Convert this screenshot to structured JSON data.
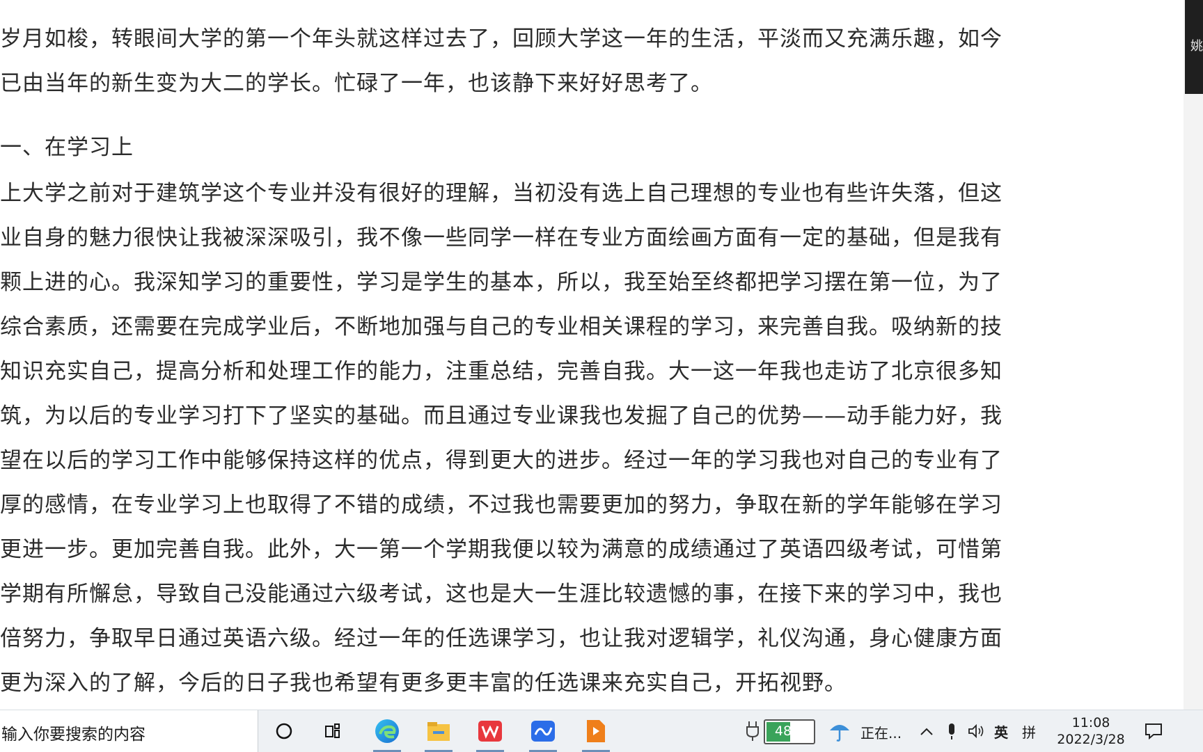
{
  "document": {
    "para1": [
      "岁月如梭，转眼间大学的第一个年头就这样过去了，回顾大学这一年的生活，平淡而又充满乐趣，如今",
      "已由当年的新生变为大二的学长。忙碌了一年，也该静下来好好思考了。"
    ],
    "heading": "一、在学习上",
    "para2": [
      "上大学之前对于建筑学这个专业并没有很好的理解，当初没有选上自己理想的专业也有些许失落，但这",
      "业自身的魅力很快让我被深深吸引，我不像一些同学一样在专业方面绘画方面有一定的基础，但是我有",
      "颗上进的心。我深知学习的重要性，学习是学生的基本，所以，我至始至终都把学习摆在第一位，为了",
      "综合素质，还需要在完成学业后，不断地加强与自己的专业相关课程的学习，来完善自我。吸纳新的技",
      "知识充实自己，提高分析和处理工作的能力，注重总结，完善自我。大一这一年我也走访了北京很多知",
      "筑，为以后的专业学习打下了坚实的基础。而且通过专业课我也发掘了自己的优势——动手能力好，我",
      "望在以后的学习工作中能够保持这样的优点，得到更大的进步。经过一年的学习我也对自己的专业有了",
      "厚的感情，在专业学习上也取得了不错的成绩，不过我也需要更加的努力，争取在新的学年能够在学习",
      "更进一步。更加完善自我。此外，大一第一个学期我便以较为满意的成绩通过了英语四级考试，可惜第",
      "学期有所懈怠，导致自己没能通过六级考试，这也是大一生涯比较遗憾的事，在接下来的学习中，我也",
      "倍努力，争取早日通过英语六级。经过一年的任选课学习，也让我对逻辑学，礼仪沟通，身心健康方面",
      "更为深入的了解，今后的日子我也希望有更多更丰富的任选课来充实自己，开拓视野。"
    ]
  },
  "side_window": {
    "label": "姚"
  },
  "taskbar": {
    "search_placeholder": "输入你要搜索的内容",
    "apps": [
      {
        "name": "cortana-icon"
      },
      {
        "name": "task-view-icon"
      },
      {
        "name": "edge-icon"
      },
      {
        "name": "file-explorer-icon"
      },
      {
        "name": "wps-icon"
      },
      {
        "name": "feishu-icon"
      },
      {
        "name": "slides-icon"
      }
    ],
    "battery_percent": "48%",
    "battery_level": 0.48,
    "weather_text": "正在...",
    "input_lang": "英",
    "ime_mode": "拼",
    "time": "11:08",
    "date": "2022/3/28"
  }
}
